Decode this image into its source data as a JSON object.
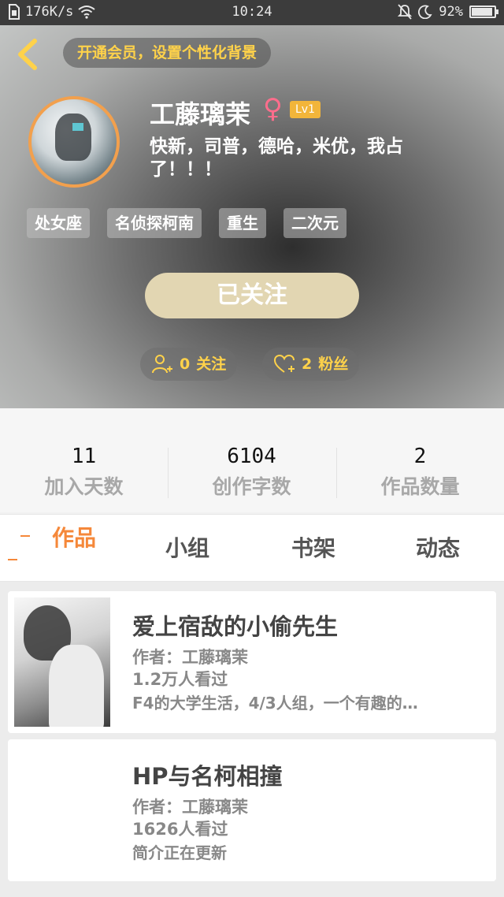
{
  "status_bar": {
    "network_speed": "176K/s",
    "time": "10:24",
    "battery": "92%",
    "battery_level": 0.92,
    "icons": [
      "sim-icon",
      "wifi-icon",
      "mute-icon",
      "moon-icon",
      "battery-icon"
    ]
  },
  "header": {
    "vip_banner": "开通会员，设置个性化背景",
    "username": "工藤璃茉",
    "gender_symbol": "♀",
    "level": "Lv1",
    "bio": "快新，司普，德哈，米优，我占了！！！",
    "tags": [
      "处女座",
      "名侦探柯南",
      "重生",
      "二次元"
    ],
    "follow_button": "已关注",
    "following": {
      "count": "0",
      "label": "关注"
    },
    "followers": {
      "count": "2",
      "label": "粉丝"
    }
  },
  "stats": [
    {
      "value": "11",
      "label": "加入天数"
    },
    {
      "value": "6104",
      "label": "创作字数"
    },
    {
      "value": "2",
      "label": "作品数量"
    }
  ],
  "tabs": [
    "作品",
    "小组",
    "书架",
    "动态"
  ],
  "works": [
    {
      "title": "爱上宿敌的小偷先生",
      "author": "作者：工藤璃茉",
      "views": "1.2万人看过",
      "description": "F4的大学生活，4/3人组，一个有趣的…"
    },
    {
      "title": "HP与名柯相撞",
      "author": "作者：工藤璃茉",
      "views": "1626人看过",
      "description": "简介正在更新"
    }
  ],
  "colors": {
    "accent": "#f5883a",
    "vip_text": "#ffd24a",
    "follow_button": "#e2d6b2",
    "avatar_ring": "#f2a04d",
    "level_badge": "#f2b53a",
    "gender": "#ff6d8c"
  }
}
